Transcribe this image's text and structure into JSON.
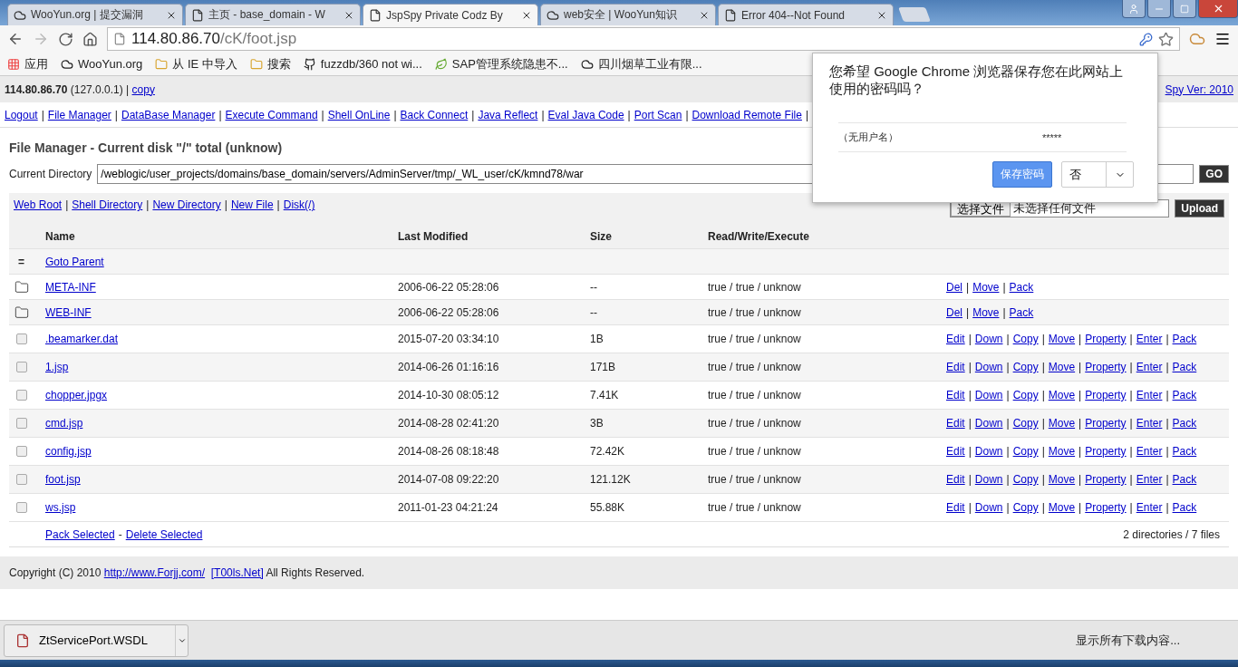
{
  "browser": {
    "tabs": [
      {
        "title": "WooYun.org | 提交漏洞",
        "kind": "cloud",
        "selected": false
      },
      {
        "title": "主页 - base_domain - W",
        "kind": "page",
        "selected": false
      },
      {
        "title": "JspSpy Private Codz By",
        "kind": "page",
        "selected": true
      },
      {
        "title": "web安全 | WooYun知识",
        "kind": "cloud",
        "selected": false
      },
      {
        "title": "Error 404--Not Found",
        "kind": "page",
        "selected": false
      }
    ],
    "address": {
      "host": "114.80.86.70",
      "path": "/cK/foot.jsp"
    },
    "bookmarks": [
      {
        "label": "应用",
        "kind": "apps"
      },
      {
        "label": "WooYun.org",
        "kind": "cloud"
      },
      {
        "label": "从 IE 中导入",
        "kind": "folder"
      },
      {
        "label": "搜索",
        "kind": "folder"
      },
      {
        "label": "fuzzdb/360 not wi...",
        "kind": "github"
      },
      {
        "label": "SAP管理系统隐患不...",
        "kind": "leaf"
      },
      {
        "label": "四川烟草工业有限...",
        "kind": "cloud"
      }
    ]
  },
  "page": {
    "info": {
      "host": "114.80.86.70",
      "local": " (127.0.0.1) | ",
      "link": "copy"
    },
    "version": "Spy Ver: 2010",
    "separator": "|",
    "nav": [
      "Logout",
      "File Manager",
      "DataBase Manager",
      "Execute Command",
      "Shell OnLine",
      "Back Connect",
      "Java Reflect",
      "Eval Java Code",
      "Port Scan",
      "Download Remote File"
    ],
    "heading": "File Manager - Current disk \"/\" total (unknow)",
    "current_directory": {
      "label": "Current Directory",
      "value": "/weblogic/user_projects/domains/base_domain/servers/AdminServer/tmp/_WL_user/cK/kmnd78/war",
      "button": "GO"
    },
    "links": [
      "Web Root",
      "Shell Directory",
      "New Directory",
      "New File",
      "Disk(/)"
    ],
    "upload": {
      "choose": "选择文件",
      "status": "未选择任何文件",
      "button": "Upload"
    },
    "columns": [
      "Name",
      "Last Modified",
      "Size",
      "Read/Write/Execute"
    ],
    "rows": [
      {
        "kind": "parent",
        "marker": "=",
        "name": "Goto Parent"
      },
      {
        "kind": "dir",
        "name": "META-INF",
        "modified": "2006-06-22 05:28:06",
        "size": "--",
        "perms": "true / true / unknow",
        "actions": [
          "Del",
          "Move",
          "Pack"
        ]
      },
      {
        "kind": "dir",
        "name": "WEB-INF",
        "modified": "2006-06-22 05:28:06",
        "size": "--",
        "perms": "true / true / unknow",
        "actions": [
          "Del",
          "Move",
          "Pack"
        ]
      },
      {
        "kind": "file",
        "checked": false,
        "name": ".beamarker.dat",
        "modified": "2015-07-20 03:34:10",
        "size": "1B",
        "perms": "true / true / unknow",
        "actions": [
          "Edit",
          "Down",
          "Copy",
          "Move",
          "Property",
          "Enter",
          "Pack"
        ]
      },
      {
        "kind": "file",
        "checked": false,
        "name": "1.jsp",
        "modified": "2014-06-26 01:16:16",
        "size": "171B",
        "perms": "true / true / unknow",
        "actions": [
          "Edit",
          "Down",
          "Copy",
          "Move",
          "Property",
          "Enter",
          "Pack"
        ]
      },
      {
        "kind": "file",
        "checked": false,
        "name": "chopper.jpgx",
        "modified": "2014-10-30 08:05:12",
        "size": "7.41K",
        "perms": "true / true / unknow",
        "actions": [
          "Edit",
          "Down",
          "Copy",
          "Move",
          "Property",
          "Enter",
          "Pack"
        ]
      },
      {
        "kind": "file",
        "checked": false,
        "name": "cmd.jsp",
        "modified": "2014-08-28 02:41:20",
        "size": "3B",
        "perms": "true / true / unknow",
        "actions": [
          "Edit",
          "Down",
          "Copy",
          "Move",
          "Property",
          "Enter",
          "Pack"
        ]
      },
      {
        "kind": "file",
        "checked": false,
        "name": "config.jsp",
        "modified": "2014-08-26 08:18:48",
        "size": "72.42K",
        "perms": "true / true / unknow",
        "actions": [
          "Edit",
          "Down",
          "Copy",
          "Move",
          "Property",
          "Enter",
          "Pack"
        ]
      },
      {
        "kind": "file",
        "checked": false,
        "name": "foot.jsp",
        "modified": "2014-07-08 09:22:20",
        "size": "121.12K",
        "perms": "true / true / unknow",
        "actions": [
          "Edit",
          "Down",
          "Copy",
          "Move",
          "Property",
          "Enter",
          "Pack"
        ]
      },
      {
        "kind": "file",
        "checked": false,
        "name": "ws.jsp",
        "modified": "2011-01-23 04:21:24",
        "size": "55.88K",
        "perms": "true / true / unknow",
        "actions": [
          "Edit",
          "Down",
          "Copy",
          "Move",
          "Property",
          "Enter",
          "Pack"
        ]
      }
    ],
    "bulk": [
      "Pack Selected",
      "Delete Selected"
    ],
    "bulk_separator": "-",
    "summary": "2 directories / 7 files",
    "copyright": {
      "prefix": "Copyright (C) 2010 ",
      "link1": "http://www.Forjj.com/",
      "link2": "[T00ls.Net]",
      "suffix": " All Rights Reserved."
    }
  },
  "popup": {
    "message": "您希望 Google Chrome 浏览器保存您在此网站上使用的密码吗？",
    "username": "（无用户名）",
    "password": "*****",
    "save": "保存密码",
    "never": "否"
  },
  "downloads": {
    "file": "ZtServicePort.WSDL",
    "show_all": "显示所有下载内容..."
  }
}
